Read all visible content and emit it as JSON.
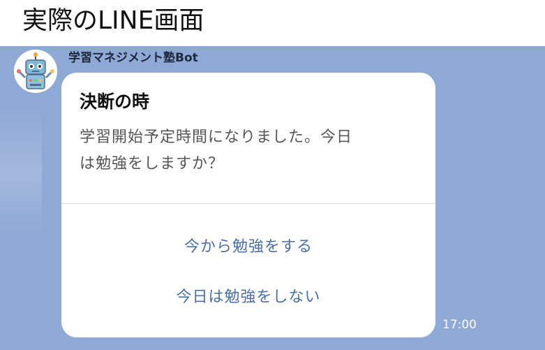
{
  "heading": "実際のLINE画面",
  "chat": {
    "sender_name": "学習マネジメント塾Bot",
    "avatar_icon": "robot-avatar-icon",
    "background_color": "#8fa9d6",
    "message": {
      "title": "決断の時",
      "body_line1": "学習開始予定時間になりました。今日",
      "body_line2": "は勉強をしますか？",
      "actions": [
        {
          "label": "今から勉強をする"
        },
        {
          "label": "今日は勉強をしない"
        }
      ],
      "action_color": "#4a6fa5",
      "timestamp": "17:00"
    }
  }
}
